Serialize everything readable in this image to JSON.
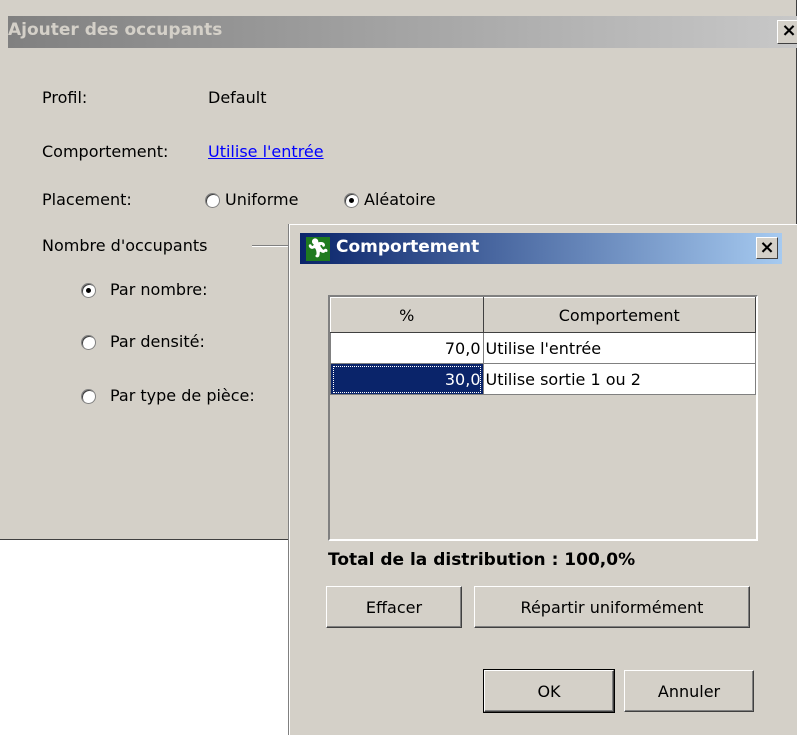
{
  "back_dialog": {
    "title": "Ajouter des occupants",
    "close_glyph": "×",
    "profil_label": "Profil:",
    "profil_value": "Default",
    "comportement_label": "Comportement:",
    "comportement_link": "Utilise l'entrée",
    "placement_label": "Placement:",
    "placement_options": [
      {
        "label": "Uniforme",
        "selected": false
      },
      {
        "label": "Aléatoire",
        "selected": true
      }
    ],
    "nombre_group_label": "Nombre d'occupants",
    "nombre_options": [
      {
        "label": "Par nombre:",
        "selected": true
      },
      {
        "label": "Par densité:",
        "selected": false
      },
      {
        "label": "Par type de pièce:",
        "selected": false
      }
    ]
  },
  "front_dialog": {
    "title": "Comportement",
    "icon": "running-man-icon",
    "close_glyph": "×",
    "table": {
      "columns": [
        "%",
        "Comportement"
      ],
      "rows": [
        {
          "percent": "70,0",
          "behavior": "Utilise l'entrée",
          "selected": false
        },
        {
          "percent": "30,0",
          "behavior": "Utilise sortie 1 ou 2",
          "selected": true
        }
      ]
    },
    "total_text": "Total de la distribution : 100,0%",
    "buttons": {
      "clear": "Effacer",
      "distribute": "Répartir uniformément",
      "ok": "OK",
      "cancel": "Annuler"
    }
  },
  "colors": {
    "dialog_bg": "#d4d0c8",
    "active_title": "#0a246a",
    "inactive_title": "#808080",
    "link": "#0000ff",
    "selection": "#0a246a"
  }
}
